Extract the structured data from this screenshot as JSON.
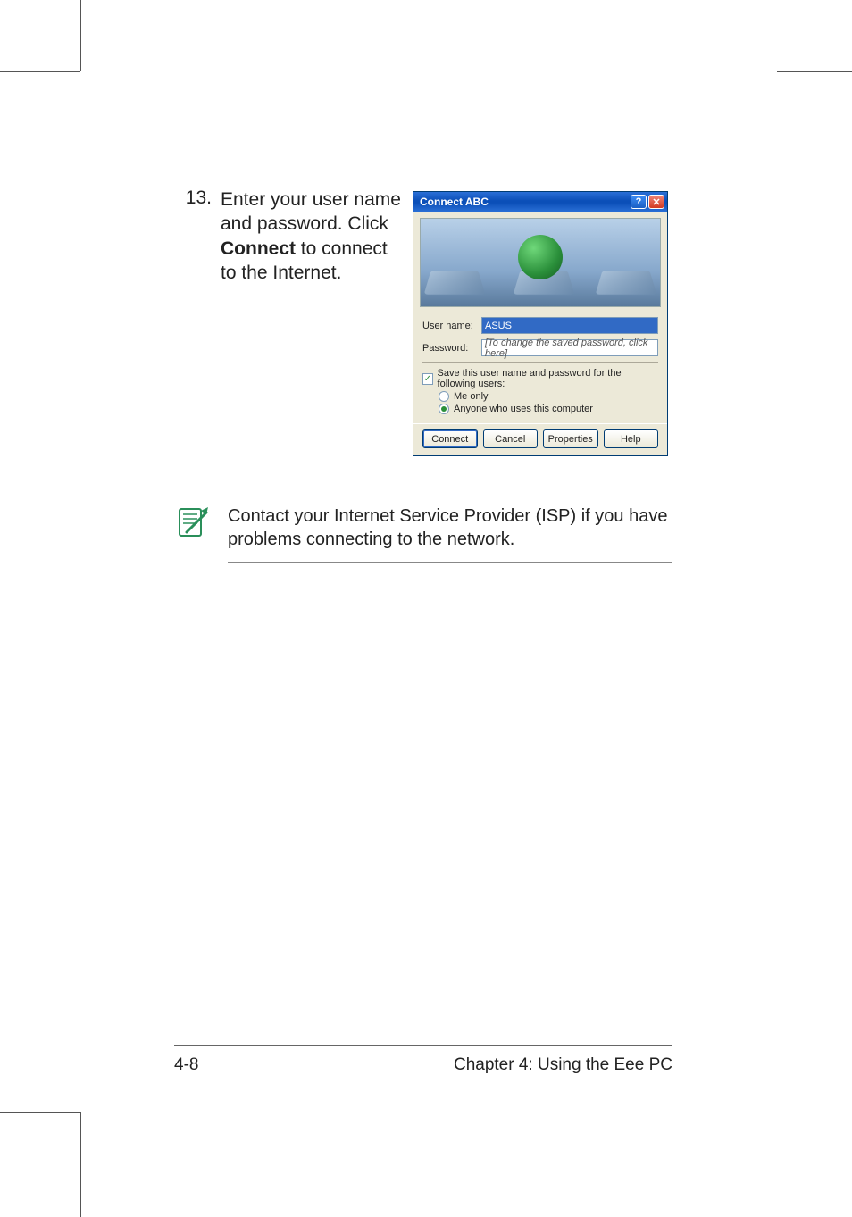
{
  "step": {
    "number": "13.",
    "text_before": "Enter your user name and password. Click ",
    "bold": "Connect",
    "text_after": " to connect to the Internet."
  },
  "dialog": {
    "title": "Connect ABC",
    "help_glyph": "?",
    "close_glyph": "✕",
    "username_label": "User name:",
    "username_value": "ASUS",
    "password_label": "Password:",
    "password_placeholder": "[To change the saved password, click here]",
    "save_checkbox_label": "Save this user name and password for the following users:",
    "radio_me_only": "Me only",
    "radio_anyone": "Anyone who uses this computer",
    "buttons": {
      "connect": "Connect",
      "cancel": "Cancel",
      "properties": "Properties",
      "help": "Help"
    }
  },
  "note": {
    "text": "Contact your Internet Service Provider (ISP) if you have problems connecting to the network."
  },
  "footer": {
    "page": "4-8",
    "chapter": "Chapter 4: Using the Eee PC"
  }
}
